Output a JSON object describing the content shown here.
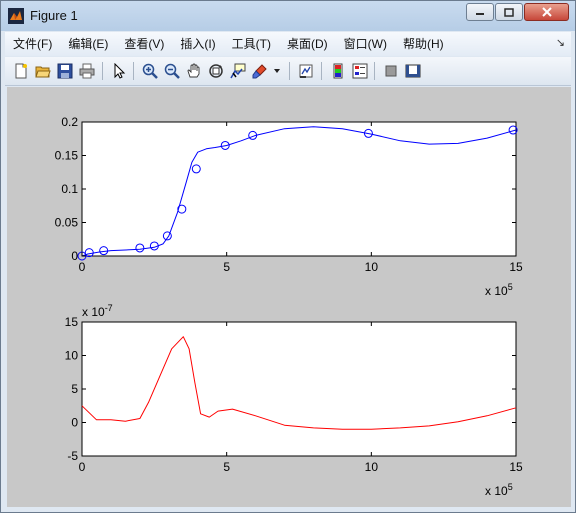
{
  "window": {
    "title": "Figure 1",
    "controls": {
      "minimize": "minimize",
      "maximize": "maximize",
      "close": "close"
    }
  },
  "menubar": {
    "items": [
      "文件(F)",
      "编辑(E)",
      "查看(V)",
      "插入(I)",
      "工具(T)",
      "桌面(D)",
      "窗口(W)",
      "帮助(H)"
    ],
    "dock_glyph": "↘"
  },
  "toolbar": {
    "icons": [
      "new-figure-icon",
      "open-file-icon",
      "save-icon",
      "print-icon",
      "arrow-cursor-icon",
      "zoom-in-icon",
      "zoom-out-icon",
      "pan-hand-icon",
      "rotate-3d-icon",
      "data-cursor-icon",
      "brush-icon",
      "brush-dropdown-icon",
      "link-plot-icon",
      "colorbar-icon",
      "legend-icon",
      "hide-plot-tools-icon",
      "show-plot-tools-icon"
    ]
  },
  "colors": {
    "series1": "#0000ff",
    "series2": "#ff0000",
    "axes_bg": "#ffffff",
    "figure_bg": "#c8c8c8"
  },
  "chart_data": [
    {
      "type": "line",
      "xlim": [
        0,
        1500000
      ],
      "ylim": [
        0,
        0.2
      ],
      "xtick_labels": [
        "0",
        "5",
        "10",
        "15"
      ],
      "ytick_labels": [
        "0",
        "0.05",
        "0.1",
        "0.15",
        "0.2"
      ],
      "x_exponent_label": "x 10",
      "x_exponent_power": "5",
      "grid": false,
      "series": [
        {
          "color": "#0000ff",
          "style": "line",
          "x": [
            0,
            20000,
            60000,
            100000,
            150000,
            200000,
            250000,
            280000,
            300000,
            330000,
            360000,
            380000,
            400000,
            430000,
            460000,
            500000,
            550000,
            600000,
            700000,
            800000,
            900000,
            1000000,
            1100000,
            1200000,
            1300000,
            1400000,
            1500000
          ],
          "y": [
            0,
            0.003,
            0.006,
            0.008,
            0.009,
            0.01,
            0.013,
            0.018,
            0.03,
            0.065,
            0.11,
            0.14,
            0.155,
            0.16,
            0.162,
            0.165,
            0.172,
            0.18,
            0.19,
            0.193,
            0.19,
            0.182,
            0.172,
            0.167,
            0.168,
            0.176,
            0.188
          ]
        },
        {
          "color": "#0000ff",
          "style": "markers",
          "marker": "o",
          "x": [
            0,
            25000,
            75000,
            200000,
            250000,
            295000,
            345000,
            395000,
            495000,
            590000,
            990000,
            1490000
          ],
          "y": [
            0,
            0.005,
            0.008,
            0.012,
            0.015,
            0.03,
            0.07,
            0.13,
            0.165,
            0.18,
            0.183,
            0.188
          ]
        }
      ]
    },
    {
      "type": "line",
      "xlim": [
        0,
        1500000
      ],
      "ylim": [
        -5e-07,
        1.5e-06
      ],
      "xtick_labels": [
        "0",
        "5",
        "10",
        "15"
      ],
      "ytick_labels": [
        "-5",
        "0",
        "5",
        "10",
        "15"
      ],
      "x_exponent_label": "x 10",
      "x_exponent_power": "5",
      "y_exponent_label": "x 10",
      "y_exponent_power": "-7",
      "grid": false,
      "series": [
        {
          "color": "#ff0000",
          "style": "line",
          "x": [
            0,
            50000,
            100000,
            150000,
            200000,
            230000,
            270000,
            310000,
            350000,
            370000,
            390000,
            410000,
            440000,
            470000,
            520000,
            600000,
            700000,
            800000,
            900000,
            1000000,
            1100000,
            1200000,
            1300000,
            1400000,
            1500000
          ],
          "y": [
            2.5e-07,
            4e-08,
            4e-08,
            2e-08,
            6e-08,
            3e-07,
            7e-07,
            1.1e-06,
            1.28e-06,
            1.1e-06,
            6e-07,
            1.3e-07,
            8e-08,
            1.7e-07,
            2e-07,
            1e-07,
            -4e-08,
            -8e-08,
            -1e-07,
            -1e-07,
            -8e-08,
            -5e-08,
            1e-08,
            1e-07,
            2.2e-07
          ]
        }
      ]
    }
  ]
}
